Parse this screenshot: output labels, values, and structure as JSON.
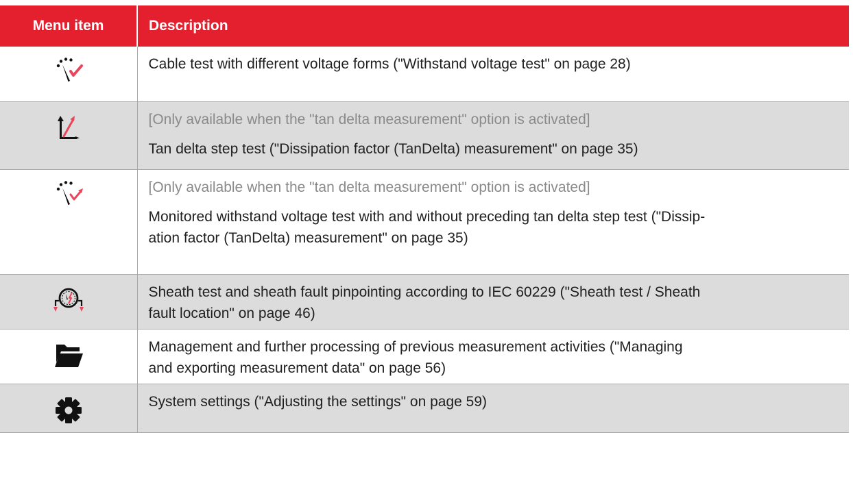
{
  "table": {
    "headers": {
      "menu_item": "Menu item",
      "description": "Description"
    },
    "rows": [
      {
        "icon": "withstand-voltage-test-icon",
        "lines": [
          "Cable test with different voltage forms (\"Withstand voltage test\" on page 28)"
        ]
      },
      {
        "icon": "tan-delta-icon",
        "note": "[Only available when the \"tan delta measurement\" option is activated]",
        "lines": [
          "Tan delta step test (\"Dissipation factor (TanDelta) measurement\" on page 35)"
        ]
      },
      {
        "icon": "monitored-withstand-test-icon",
        "note": "[Only available when the \"tan delta measurement\" option is activated]",
        "lines": [
          "Monitored withstand voltage test with and without preceding tan delta step test (\"Dissip-",
          "ation factor (TanDelta) measurement\" on page 35)"
        ]
      },
      {
        "icon": "sheath-test-icon",
        "lines": [
          "Sheath test and sheath fault pinpointing according to IEC 60229 (\"Sheath test / Sheath",
          "fault location\" on page 46)"
        ]
      },
      {
        "icon": "folder-icon",
        "lines": [
          "Management and further processing of previous measurement activities (\"Managing",
          "and exporting measurement data\" on page 56)"
        ]
      },
      {
        "icon": "gear-icon",
        "lines": [
          "System settings (\"Adjusting the settings\" on page 59)"
        ]
      }
    ]
  },
  "colors": {
    "header_background": "#e4202e",
    "header_text": "#ffffff",
    "row_alt_background": "#dcdcdc",
    "note_text": "#8a8a8a",
    "accent_pink": "#e8465c"
  }
}
